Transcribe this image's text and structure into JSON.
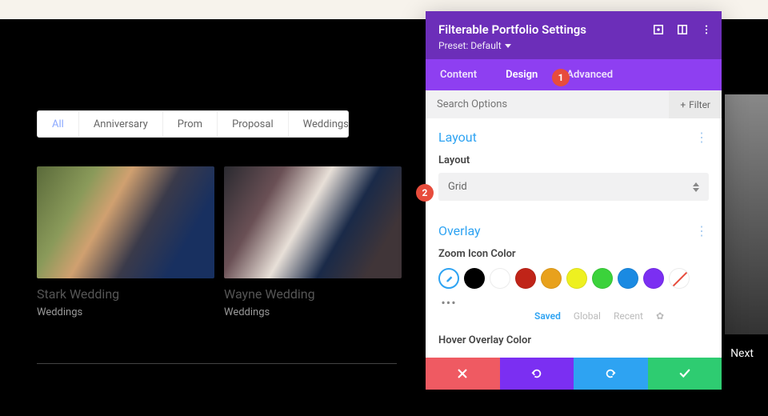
{
  "filters": {
    "items": [
      "All",
      "Anniversary",
      "Prom",
      "Proposal",
      "Weddings"
    ],
    "active": 0
  },
  "portfolio": {
    "items": [
      {
        "title": "Stark Wedding",
        "category": "Weddings"
      },
      {
        "title": "Wayne Wedding",
        "category": "Weddings"
      }
    ]
  },
  "nav": {
    "next": "Next"
  },
  "panel": {
    "title": "Filterable Portfolio Settings",
    "preset": "Preset: Default",
    "tabs": {
      "content": "Content",
      "design": "Design",
      "advanced": "Advanced"
    },
    "search": {
      "placeholder": "Search Options",
      "filter_btn": "Filter",
      "plus": "+"
    },
    "layout": {
      "section": "Layout",
      "label": "Layout",
      "value": "Grid"
    },
    "overlay": {
      "section": "Overlay",
      "zoom_label": "Zoom Icon Color",
      "hover_label": "Hover Overlay Color",
      "swatches": [
        "#000000",
        "#ffffff",
        "#c02418",
        "#e8a11c",
        "#eef020",
        "#3bd23b",
        "#1a8ae2",
        "#7b2ff2"
      ],
      "palette": {
        "saved": "Saved",
        "global": "Global",
        "recent": "Recent"
      }
    }
  },
  "annotations": {
    "a1": "1",
    "a2": "2"
  }
}
